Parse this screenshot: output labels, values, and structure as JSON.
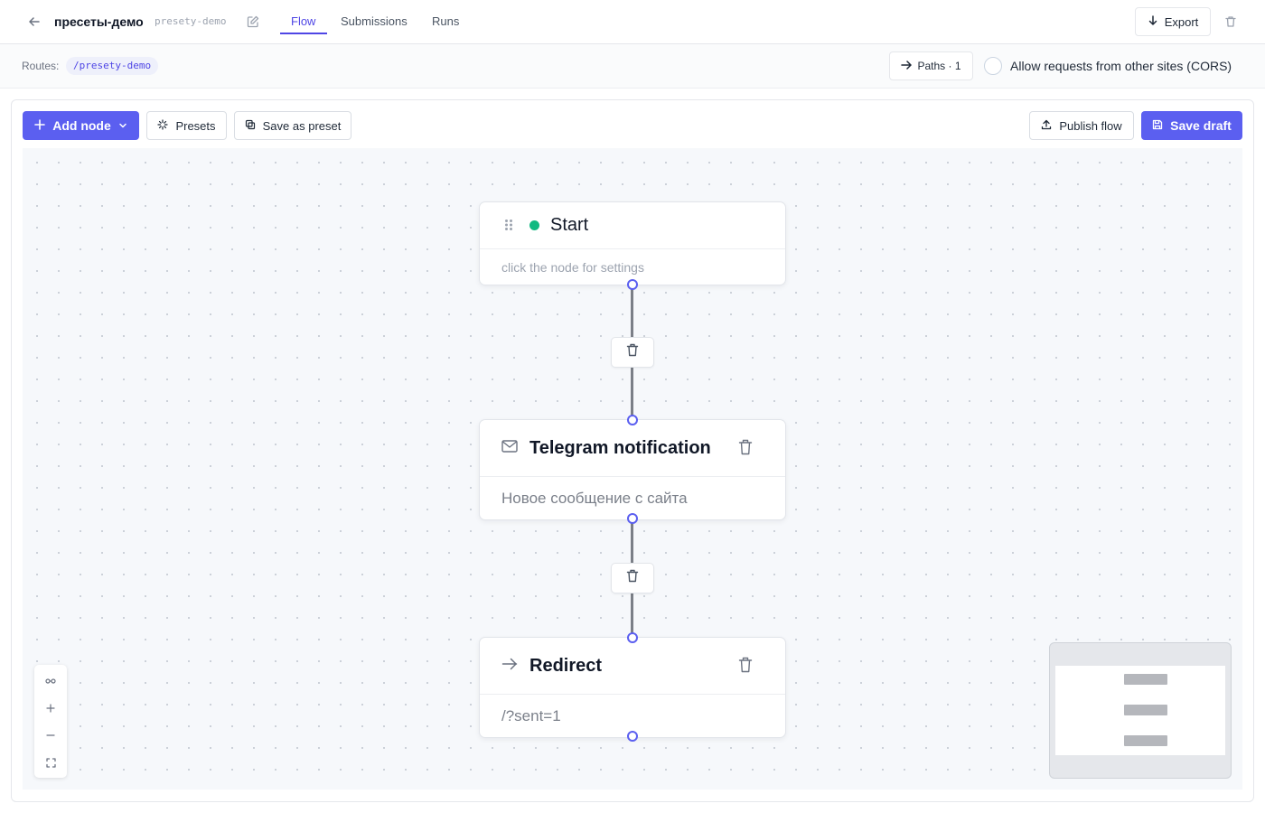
{
  "header": {
    "title": "пресеты-демо",
    "slug": "presety-demo",
    "tabs": [
      {
        "label": "Flow",
        "active": true
      },
      {
        "label": "Submissions",
        "active": false
      },
      {
        "label": "Runs",
        "active": false
      }
    ],
    "export_label": "Export"
  },
  "routes": {
    "label": "Routes:",
    "chip": "/presety-demo",
    "paths_label": "Paths · 1",
    "cors_label": "Allow requests from other sites (CORS)",
    "cors_checked": false
  },
  "toolbar": {
    "add_node_label": "Add node",
    "presets_label": "Presets",
    "save_preset_label": "Save as preset",
    "publish_label": "Publish flow",
    "save_draft_label": "Save draft"
  },
  "nodes": {
    "start": {
      "title": "Start",
      "subtitle": "click the node for settings",
      "status_color": "#10b981"
    },
    "telegram": {
      "title": "Telegram notification",
      "subtitle": "Новое сообщение с сайта",
      "icon": "mail-icon"
    },
    "redirect": {
      "title": "Redirect",
      "subtitle": "/?sent=1",
      "icon": "arrow-right-icon"
    }
  },
  "colors": {
    "accent": "#5b5ff0",
    "edge": "#7b7f87",
    "canvas": "#f6f8fb"
  }
}
